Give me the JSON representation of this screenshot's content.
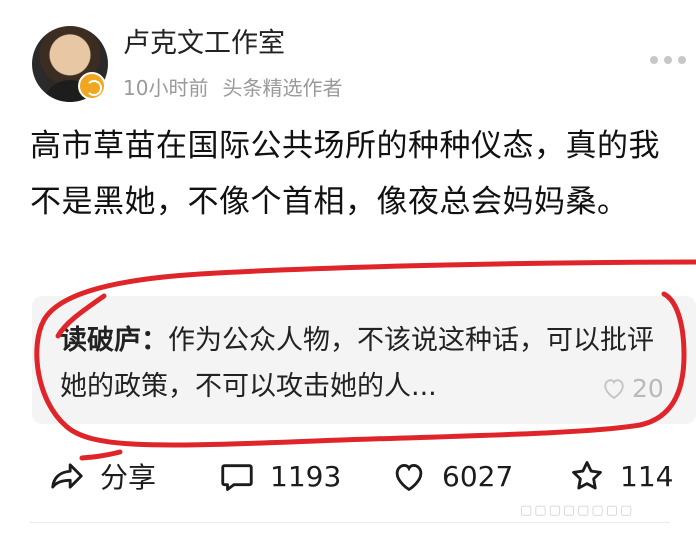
{
  "author": {
    "name": "卢克文工作室",
    "time": "10小时前",
    "label": "头条精选作者"
  },
  "post": {
    "text": "高市草苗在国际公共场所的种种仪态，真的我不是黑她，不像个首相，像夜总会妈妈桑。"
  },
  "comment": {
    "author": "读破庐：",
    "text": "作为公众人物，不该说这种话，可以批评她的政策，不可以攻击她的人...",
    "likes": "20"
  },
  "actions": {
    "share": "分享",
    "comments": "1193",
    "likes": "6027",
    "favorites": "114"
  },
  "colors": {
    "annotation": "#e0252a",
    "meta": "#9a9a9a",
    "badge": "#f0a621",
    "comment_bg": "#f4f4f4"
  },
  "icons": {
    "more": "more-dots-icon",
    "share": "share-icon",
    "comment": "comment-icon",
    "like": "heart-icon",
    "favorite": "star-icon"
  }
}
